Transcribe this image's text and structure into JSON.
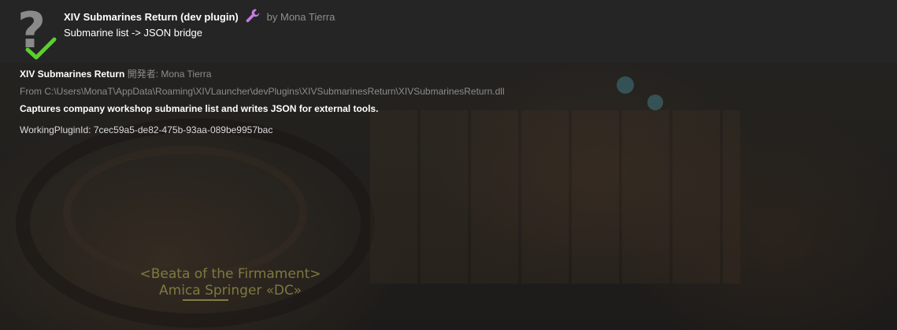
{
  "plugin_entry": {
    "title": "XIV Submarines Return (dev plugin)",
    "by_line": "by Mona Tierra",
    "subtitle": "Submarine list -> JSON bridge",
    "icon": "question-mark-icon",
    "status_icon": "checkmark-icon",
    "dev_icon": "wrench-icon"
  },
  "details": {
    "name": "XIV Submarines Return",
    "developer_label": "開発者: Mona Tierra",
    "path": "From C:\\Users\\MonaT\\AppData\\Roaming\\XIVLauncher\\devPlugins\\XIVSubmarinesReturn\\XIVSubmarinesReturn.dll",
    "description": "Captures company workshop submarine list and writes JSON for external tools.",
    "working_plugin_id": "WorkingPluginId: 7cec59a5-de82-475b-93aa-089be9957bac"
  },
  "game_nameplate": {
    "title": "<Beata of the Firmament>",
    "name": "Amica Springer «DC»"
  },
  "colors": {
    "panel_bg": "#262626",
    "check_green": "#5ccf2e",
    "wrench_purple": "#c77be0",
    "muted_text": "#8c8c8c"
  }
}
